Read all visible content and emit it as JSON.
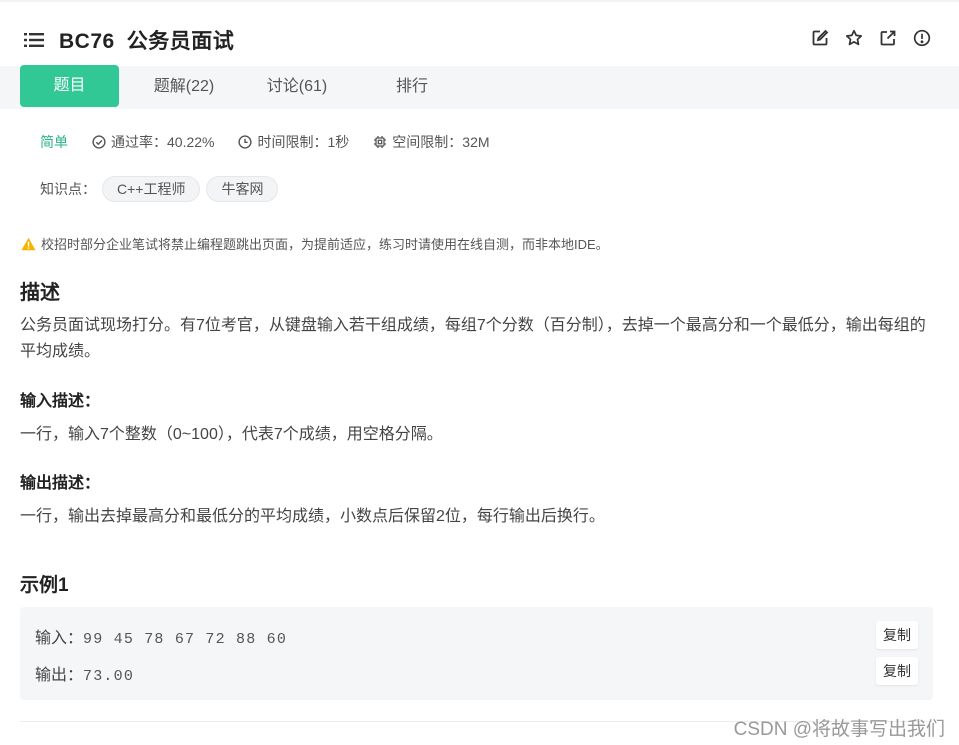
{
  "header": {
    "code": "BC76",
    "name": "公务员面试",
    "icons": [
      "edit-icon",
      "star-icon",
      "external-link-icon",
      "report-icon"
    ]
  },
  "tabs": [
    {
      "label": "题目",
      "active": true
    },
    {
      "label": "题解(22)",
      "active": false
    },
    {
      "label": "讨论(61)",
      "active": false
    },
    {
      "label": "排行",
      "active": false
    }
  ],
  "meta": {
    "difficulty": "简单",
    "pass_rate": "通过率：40.22%",
    "time_limit": "时间限制：1秒",
    "space_limit": "空间限制：32M"
  },
  "knowledge": {
    "label": "知识点：",
    "tags": [
      "C++工程师",
      "牛客网"
    ]
  },
  "notice": "校招时部分企业笔试将禁止编程题跳出页面，为提前适应，练习时请使用在线自测，而非本地IDE。",
  "description": {
    "heading": "描述",
    "text": "公务员面试现场打分。有7位考官，从键盘输入若干组成绩，每组7个分数（百分制），去掉一个最高分和一个最低分，输出每组的平均成绩。"
  },
  "input_desc": {
    "heading": "输入描述：",
    "text": "一行，输入7个整数（0~100），代表7个成绩，用空格分隔。"
  },
  "output_desc": {
    "heading": "输出描述：",
    "text": "一行，输出去掉最高分和最低分的平均成绩，小数点后保留2位，每行输出后换行。"
  },
  "example": {
    "heading": "示例1",
    "input_label": "输入：",
    "input_value": "99 45 78 67 72 88 60",
    "output_label": "输出：",
    "output_value": "73.00",
    "copy_label": "复制"
  },
  "watermark": "CSDN @将故事写出我们",
  "colors": {
    "accent": "#32c895",
    "difficulty": "#2ab38a",
    "warning": "#f5b400"
  }
}
